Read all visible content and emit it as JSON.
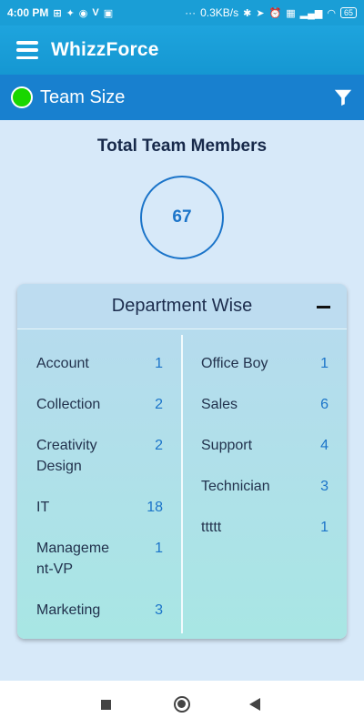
{
  "status_bar": {
    "time": "4:00 PM",
    "speed": "0.3KB/s",
    "battery": "65",
    "left_icons": [
      "plus-square-icon",
      "twitter-icon",
      "game-icon",
      "v-icon",
      "v-box-icon"
    ],
    "more": "···"
  },
  "app_bar": {
    "title": "WhizzForce"
  },
  "section": {
    "title": "Team Size",
    "indicator_color": "#19d600"
  },
  "summary": {
    "label": "Total Team Members",
    "count": "67"
  },
  "department_card": {
    "title": "Department Wise",
    "left_items": [
      {
        "name": "Account",
        "count": "1"
      },
      {
        "name": "Collection",
        "count": "2"
      },
      {
        "name": "Creativity Design",
        "count": "2"
      },
      {
        "name": "IT",
        "count": "18"
      },
      {
        "name": "Manageme nt-VP",
        "count": "1"
      },
      {
        "name": "Marketing",
        "count": "3"
      }
    ],
    "right_items": [
      {
        "name": "Office Boy",
        "count": "1"
      },
      {
        "name": "Sales",
        "count": "6"
      },
      {
        "name": "Support",
        "count": "4"
      },
      {
        "name": "Technician",
        "count": "3"
      },
      {
        "name": "ttttt",
        "count": "1"
      }
    ]
  },
  "colors": {
    "primary": "#1a9ed6",
    "section_bar": "#1880cf",
    "accent": "#1b74c9"
  }
}
